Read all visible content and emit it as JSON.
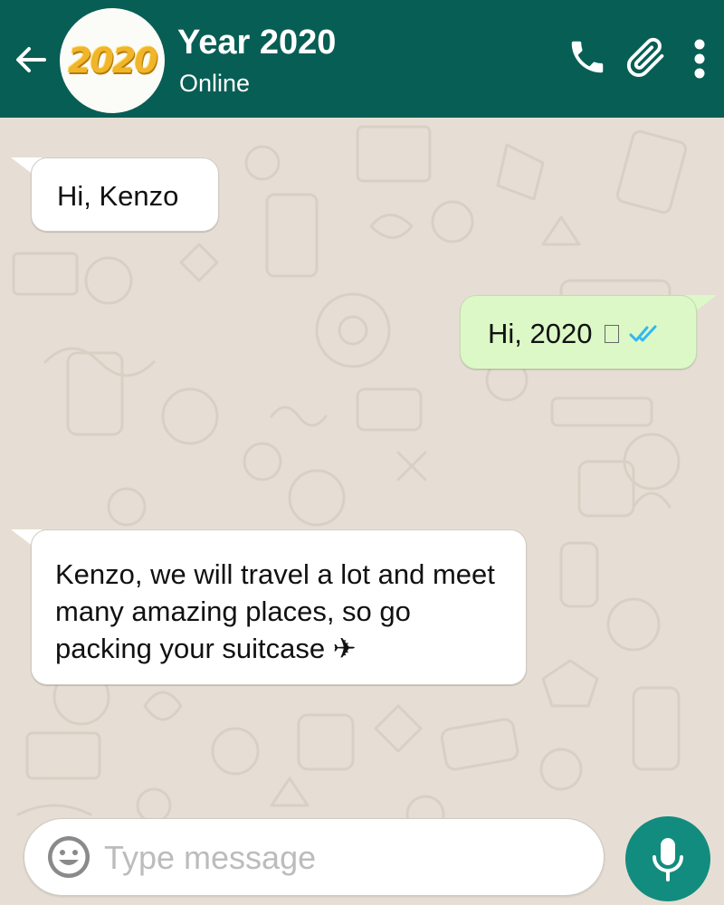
{
  "header": {
    "avatar_text": "2020",
    "title": "Year 2020",
    "status": "Online",
    "icons": [
      "back-arrow-icon",
      "phone-icon",
      "paperclip-icon",
      "more-vert-icon"
    ],
    "color": "#075e54"
  },
  "messages": [
    {
      "direction": "incoming",
      "text": "Hi, Kenzo"
    },
    {
      "direction": "outgoing",
      "text": "Hi, 2020",
      "status": "read"
    },
    {
      "direction": "incoming",
      "text": "Kenzo, we will travel a lot and meet many amazing places, so go packing your suitcase ✈"
    }
  ],
  "composer": {
    "placeholder": "Type message",
    "value": "",
    "icons": [
      "emoji-icon",
      "mic-icon"
    ],
    "mic_color": "#128c7e"
  },
  "colors": {
    "outgoing_bubble": "#dcf8c6",
    "incoming_bubble": "#ffffff",
    "read_check": "#34b7f1",
    "wallpaper": "#e6ded4"
  }
}
